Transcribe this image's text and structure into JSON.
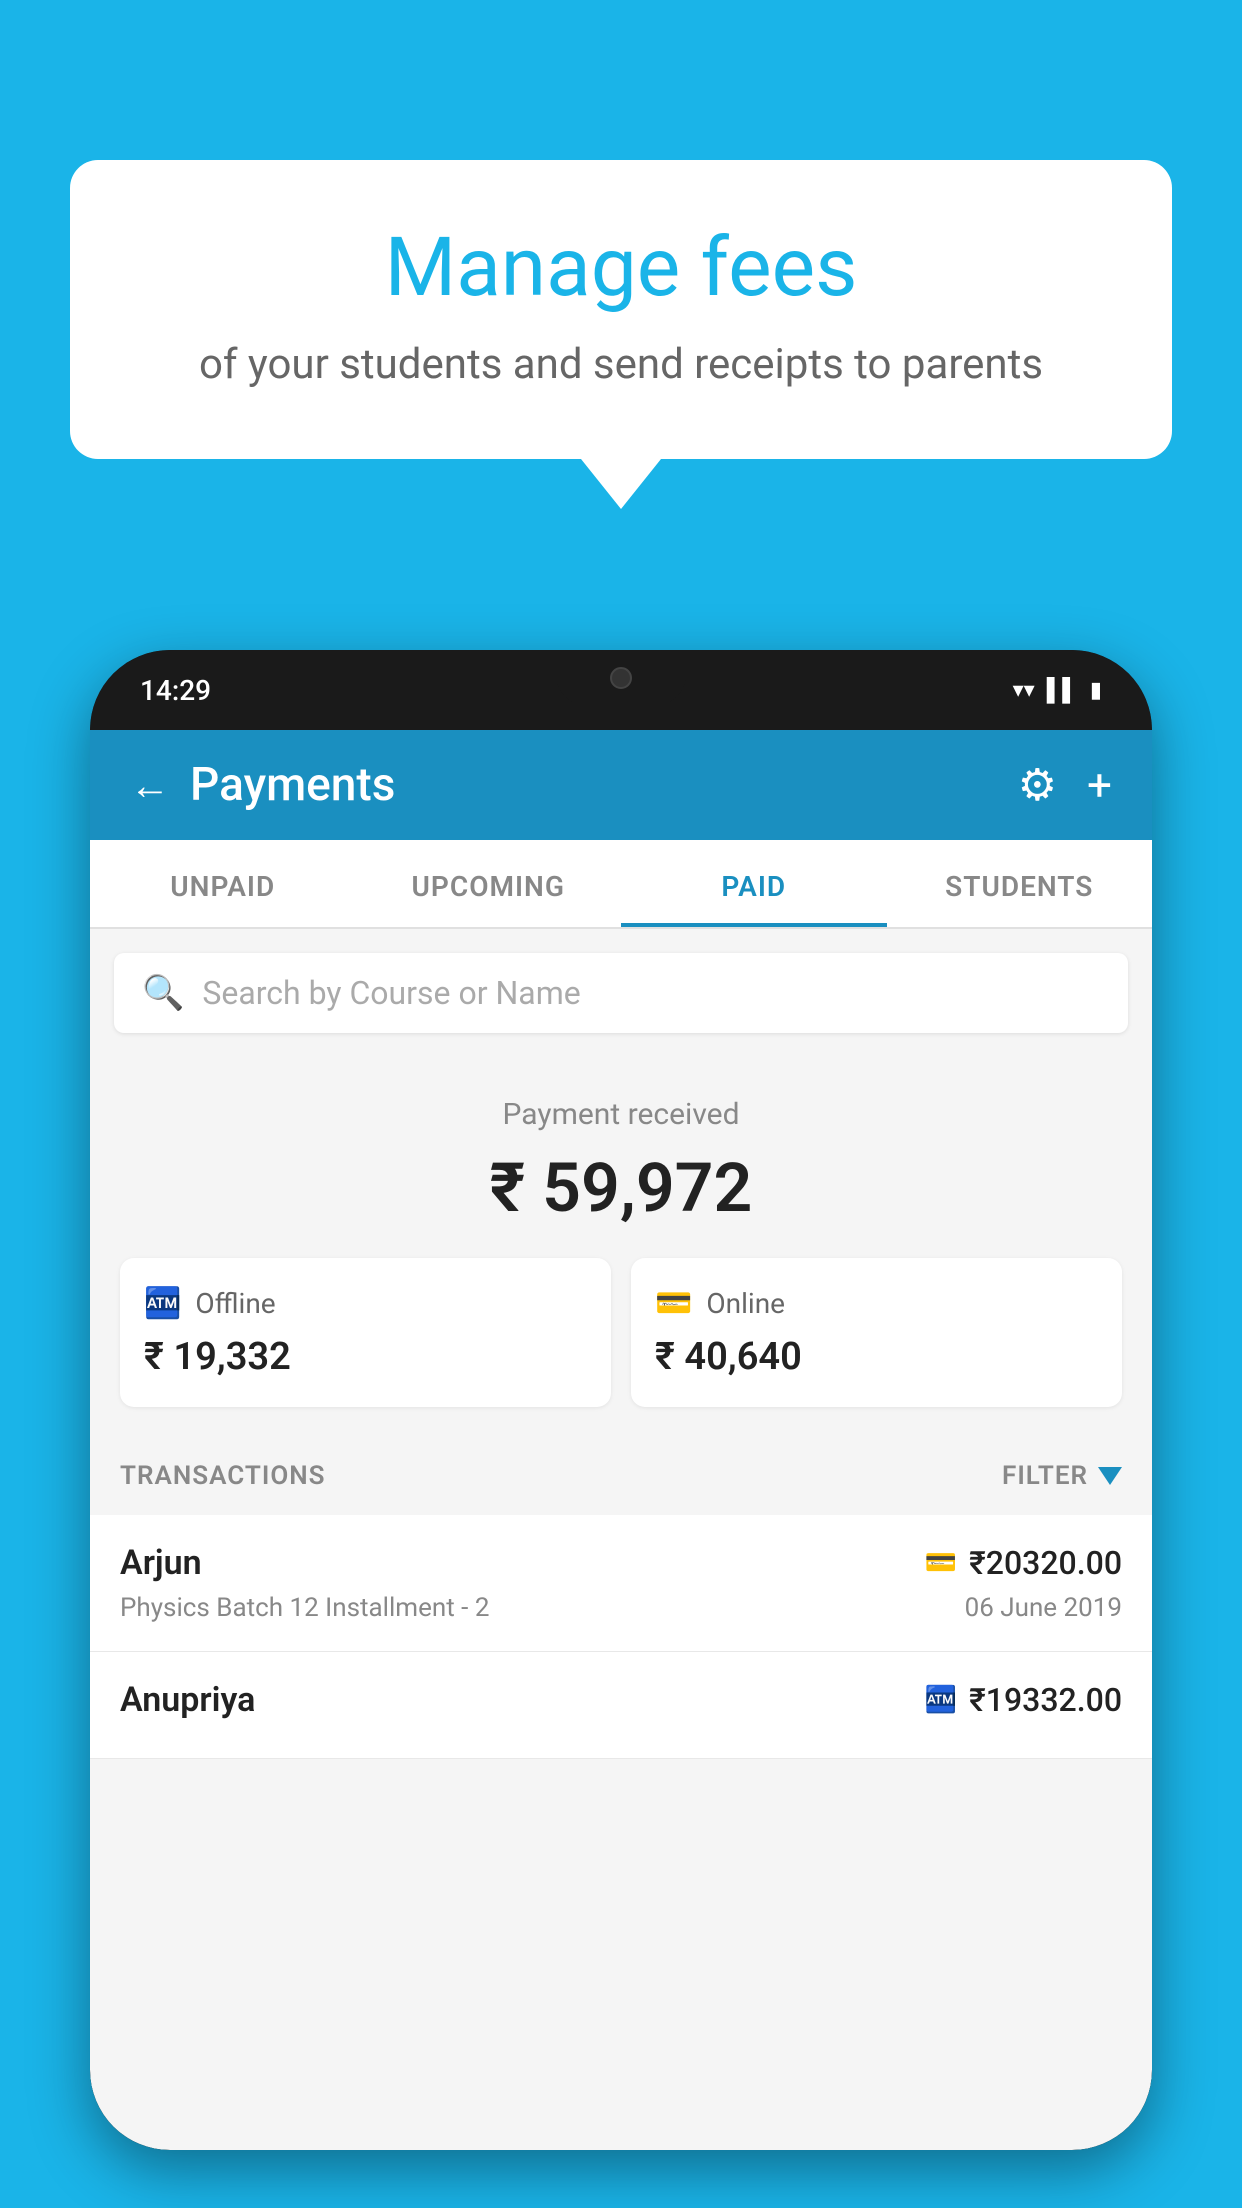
{
  "background_color": "#1ab4e8",
  "speech_bubble": {
    "title": "Manage fees",
    "subtitle": "of your students and send receipts to parents"
  },
  "phone": {
    "status_bar": {
      "time": "14:29"
    },
    "header": {
      "title": "Payments",
      "back_label": "←",
      "gear_label": "⚙",
      "plus_label": "+"
    },
    "tabs": [
      {
        "label": "UNPAID",
        "active": false
      },
      {
        "label": "UPCOMING",
        "active": false
      },
      {
        "label": "PAID",
        "active": true
      },
      {
        "label": "STUDENTS",
        "active": false
      }
    ],
    "search": {
      "placeholder": "Search by Course or Name"
    },
    "payment_summary": {
      "label": "Payment received",
      "amount": "₹ 59,972",
      "offline": {
        "label": "Offline",
        "amount": "₹ 19,332"
      },
      "online": {
        "label": "Online",
        "amount": "₹ 40,640"
      }
    },
    "transactions": {
      "header_label": "TRANSACTIONS",
      "filter_label": "FILTER",
      "items": [
        {
          "name": "Arjun",
          "course": "Physics Batch 12 Installment - 2",
          "amount": "₹20320.00",
          "date": "06 June 2019",
          "type": "online"
        },
        {
          "name": "Anupriya",
          "course": "",
          "amount": "₹19332.00",
          "date": "",
          "type": "offline"
        }
      ]
    }
  }
}
